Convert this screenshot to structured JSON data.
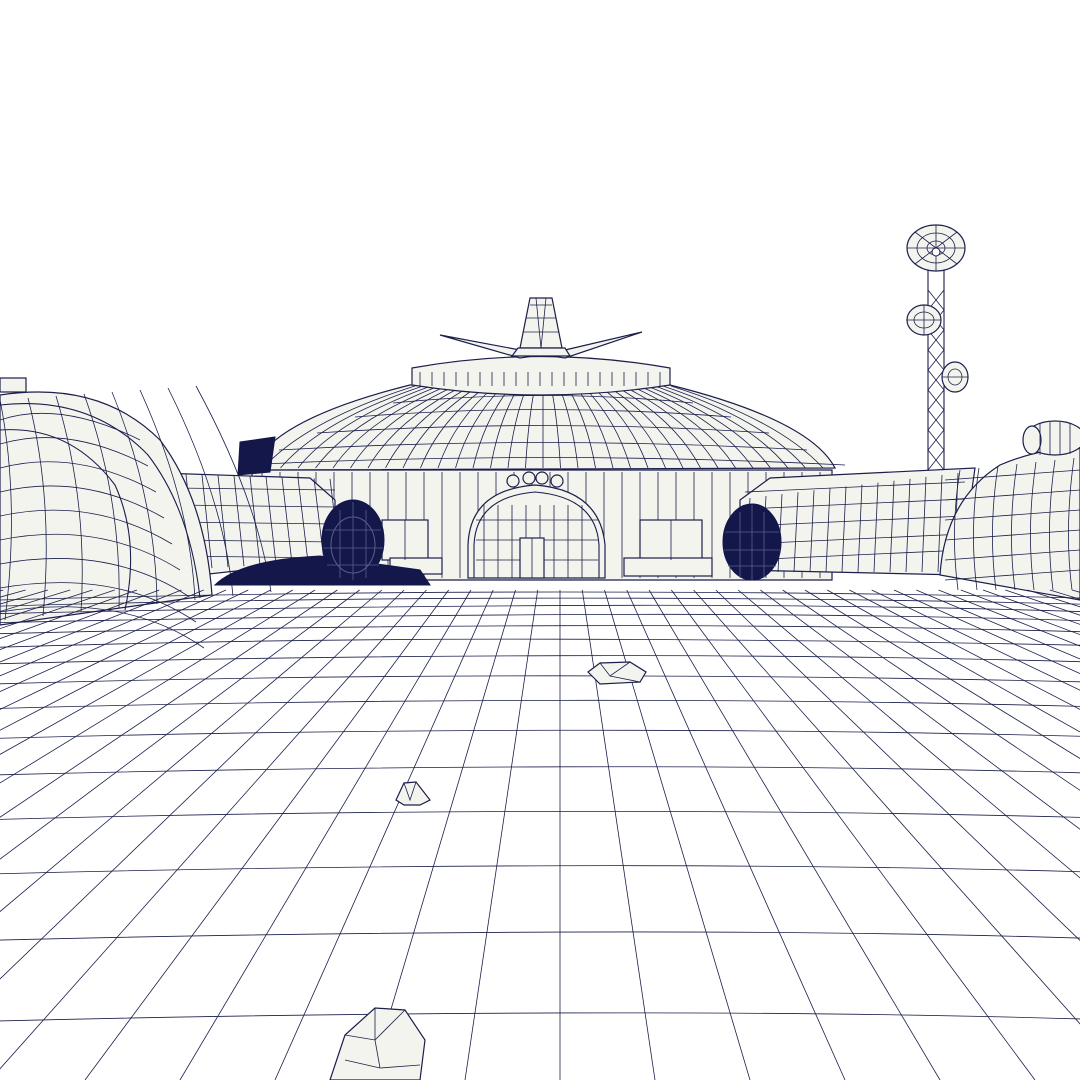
{
  "scene": {
    "subject": "wireframe-3d-render",
    "colors": {
      "background": "#ffffff",
      "wire": "#1b1f4a",
      "surface": "#f4f4ef",
      "dark_mesh": "#14174a"
    }
  }
}
